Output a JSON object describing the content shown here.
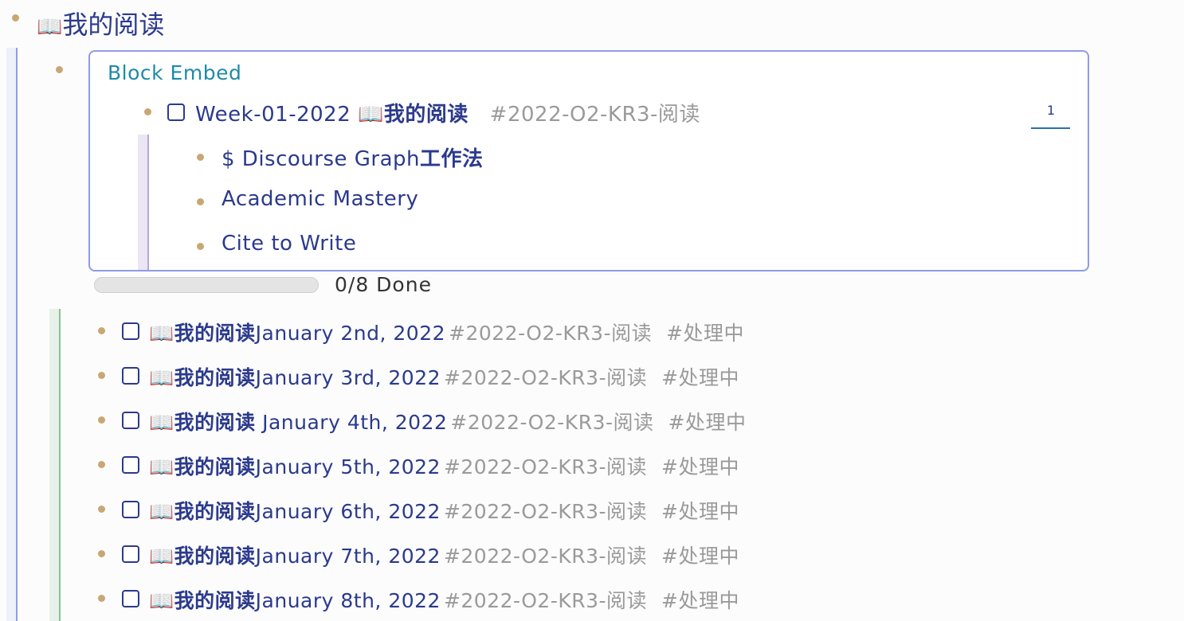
{
  "page": {
    "title": "我的阅读",
    "title_icon": "open-book-icon",
    "title_emoji": "📖"
  },
  "embed": {
    "label": "Block Embed",
    "ref_count": "1",
    "parent": {
      "text": "Week-01-2022 ",
      "emoji": "📖",
      "bold_text": "我的阅读",
      "tag": "#2022-O2-KR3-阅读",
      "checked": false
    },
    "children": [
      {
        "text": "$ Discourse Graph",
        "bold_text": "工作法"
      },
      {
        "text": "Academic Mastery",
        "bold_text": ""
      },
      {
        "text": "Cite to Write",
        "bold_text": ""
      }
    ]
  },
  "progress": {
    "done": 0,
    "total": 8,
    "fraction": 0,
    "label": "0/8 Done"
  },
  "tasks": [
    {
      "emoji": "📖",
      "bold_text": "我的阅读",
      "date": "January 2nd, 2022",
      "tag1": "#2022-O2-KR3-阅读",
      "tag2": "#处理中",
      "checked": false
    },
    {
      "emoji": "📖",
      "bold_text": "我的阅读",
      "date": "January 3rd, 2022",
      "tag1": "#2022-O2-KR3-阅读",
      "tag2": "#处理中",
      "checked": false
    },
    {
      "emoji": "📖",
      "bold_text": "我的阅读",
      "date": " January 4th, 2022",
      "tag1": "#2022-O2-KR3-阅读",
      "tag2": "#处理中",
      "checked": false
    },
    {
      "emoji": "📖",
      "bold_text": "我的阅读",
      "date": "January 5th, 2022",
      "tag1": "#2022-O2-KR3-阅读",
      "tag2": "#处理中",
      "checked": false
    },
    {
      "emoji": "📖",
      "bold_text": "我的阅读",
      "date": "January 6th, 2022",
      "tag1": "#2022-O2-KR3-阅读",
      "tag2": "#处理中",
      "checked": false
    },
    {
      "emoji": "📖",
      "bold_text": "我的阅读",
      "date": "January 7th, 2022",
      "tag1": "#2022-O2-KR3-阅读",
      "tag2": "#处理中",
      "checked": false
    },
    {
      "emoji": "📖",
      "bold_text": "我的阅读",
      "date": "January 8th, 2022",
      "tag1": "#2022-O2-KR3-阅读",
      "tag2": "#处理中",
      "checked": false
    }
  ],
  "colors": {
    "bullet": "#c9a774",
    "link_text": "#2b3a8c",
    "tag_text": "#9a9a9a",
    "embed_border": "#8f9be8",
    "embed_label": "#1f8aa8",
    "nest_line_blue": "#8f9be8",
    "nest_line_green": "#8cbf96",
    "nest_line_purple": "#b9a6d6"
  }
}
